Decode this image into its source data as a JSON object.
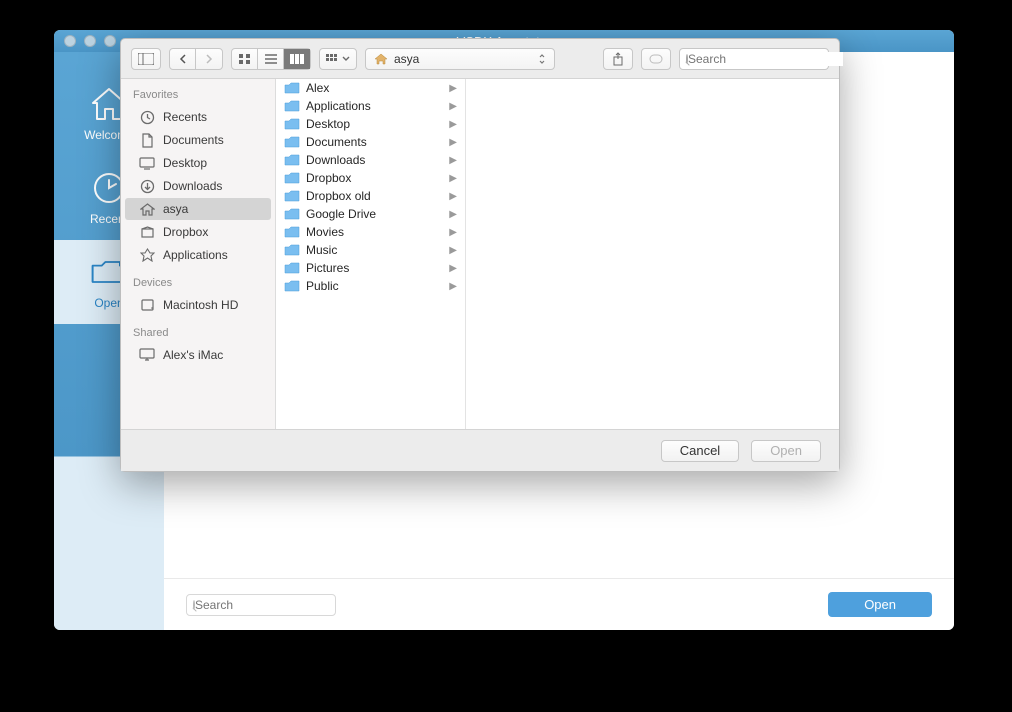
{
  "window": {
    "title": "VSDX Annotator"
  },
  "sidebar": {
    "items": [
      {
        "label": "Welcome",
        "icon": "home"
      },
      {
        "label": "Recent",
        "icon": "clock"
      },
      {
        "label": "Open",
        "icon": "folder-open",
        "selected": true
      }
    ]
  },
  "bottom": {
    "search_placeholder": "Search",
    "open_label": "Open"
  },
  "dialog": {
    "path_label": "asya",
    "search_placeholder": "Search",
    "buttons": {
      "cancel": "Cancel",
      "open": "Open"
    },
    "sidebar_sections": [
      {
        "title": "Favorites",
        "items": [
          {
            "label": "Recents",
            "icon": "recents"
          },
          {
            "label": "Documents",
            "icon": "documents"
          },
          {
            "label": "Desktop",
            "icon": "desktop"
          },
          {
            "label": "Downloads",
            "icon": "downloads"
          },
          {
            "label": "asya",
            "icon": "home",
            "active": true
          },
          {
            "label": "Dropbox",
            "icon": "dropbox"
          },
          {
            "label": "Applications",
            "icon": "apps"
          }
        ]
      },
      {
        "title": "Devices",
        "items": [
          {
            "label": "Macintosh HD",
            "icon": "disk"
          }
        ]
      },
      {
        "title": "Shared",
        "items": [
          {
            "label": "Alex's iMac",
            "icon": "imac"
          }
        ]
      }
    ],
    "column1": [
      {
        "label": "Alex",
        "kind": "folder"
      },
      {
        "label": "Applications",
        "kind": "folder-app"
      },
      {
        "label": "Desktop",
        "kind": "folder"
      },
      {
        "label": "Documents",
        "kind": "folder-doc"
      },
      {
        "label": "Downloads",
        "kind": "folder-dl"
      },
      {
        "label": "Dropbox",
        "kind": "folder"
      },
      {
        "label": "Dropbox old",
        "kind": "folder"
      },
      {
        "label": "Google Drive",
        "kind": "folder-gd"
      },
      {
        "label": "Movies",
        "kind": "folder-mov"
      },
      {
        "label": "Music",
        "kind": "folder-mus"
      },
      {
        "label": "Pictures",
        "kind": "folder-pic"
      },
      {
        "label": "Public",
        "kind": "folder-pub"
      }
    ]
  }
}
